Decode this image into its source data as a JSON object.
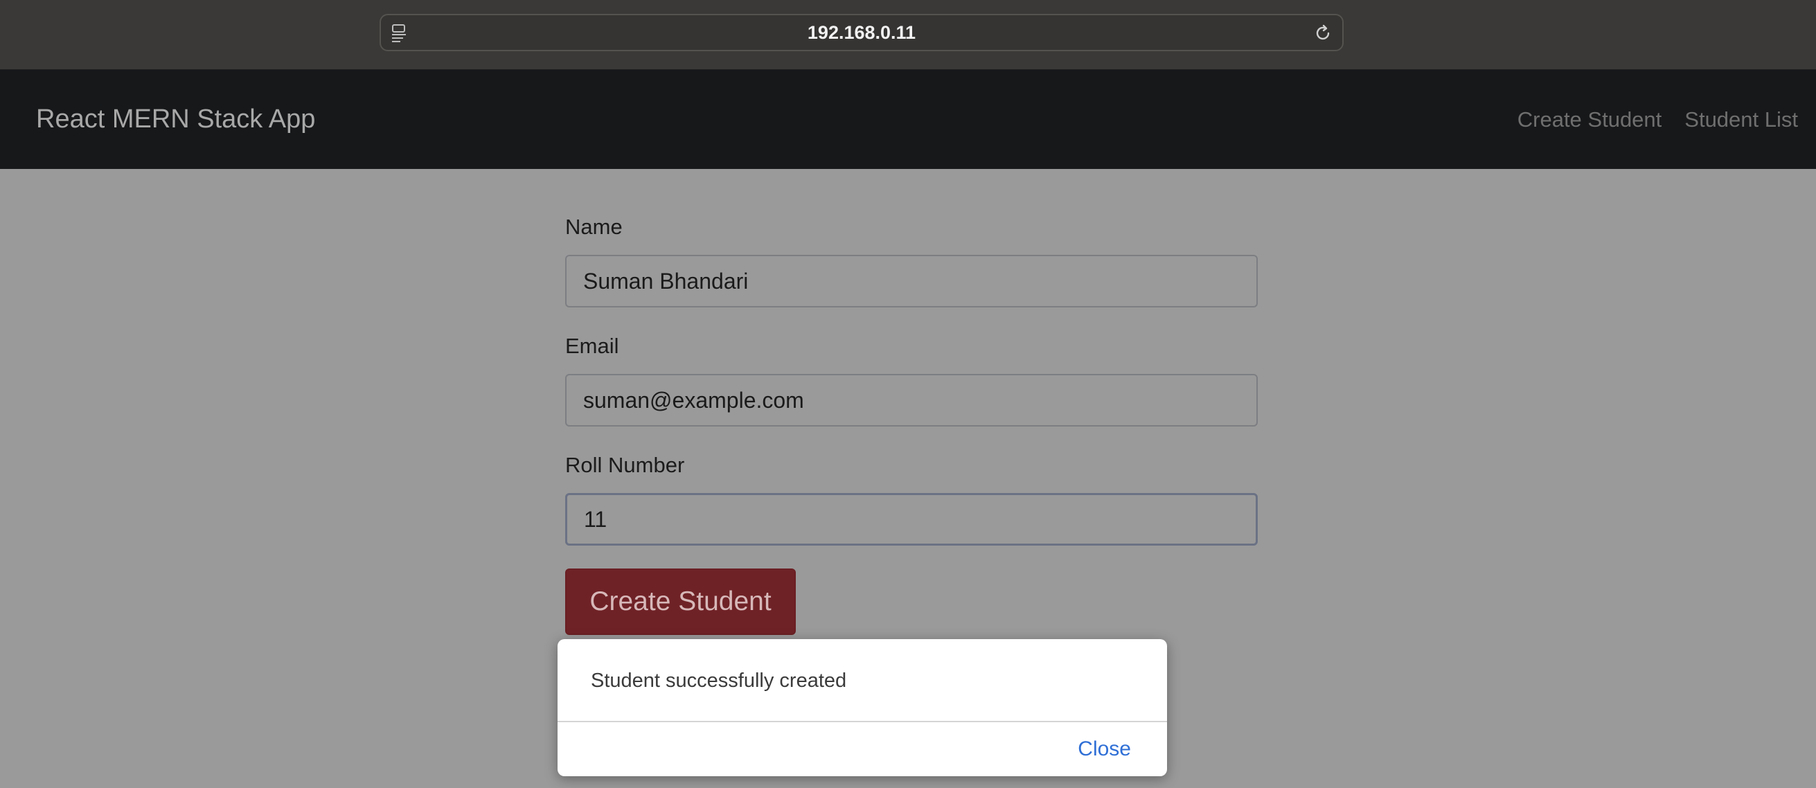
{
  "browser": {
    "url": "192.168.0.11"
  },
  "navbar": {
    "brand": "React MERN Stack App",
    "links": [
      {
        "label": "Create Student"
      },
      {
        "label": "Student List"
      }
    ]
  },
  "form": {
    "name": {
      "label": "Name",
      "value": "Suman Bhandari"
    },
    "email": {
      "label": "Email",
      "value": "suman@example.com"
    },
    "roll_number": {
      "label": "Roll Number",
      "value": "11"
    },
    "submit_label": "Create Student"
  },
  "dialog": {
    "message": "Student successfully created",
    "close_label": "Close"
  },
  "colors": {
    "navbar_bg": "#17181a",
    "overlay_bg": "#9a9a9a",
    "submit_button": "#6f2226",
    "link_blue": "#2f6fd6"
  },
  "icons": {
    "reader": "reader-mode-icon",
    "reload": "reload-icon"
  }
}
